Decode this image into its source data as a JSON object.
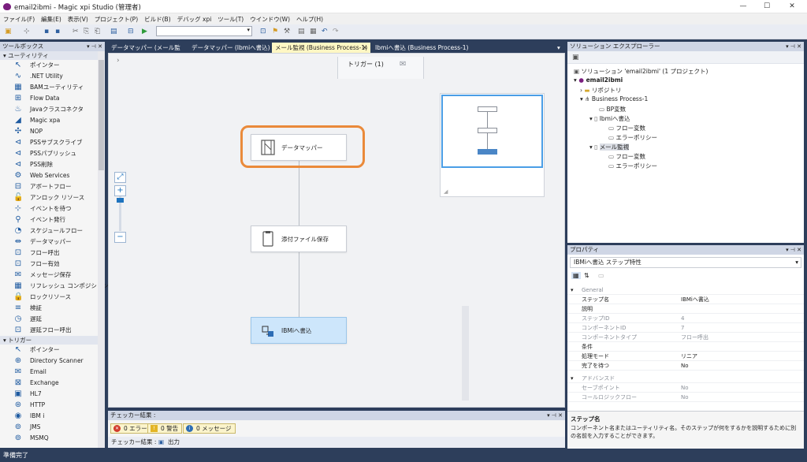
{
  "window": {
    "title": "email2ibmi - Magic xpi Studio (管理者)",
    "minimize": "—",
    "maximize": "☐",
    "close": "✕"
  },
  "menu": [
    "ファイル(F)",
    "編集(E)",
    "表示(V)",
    "プロジェクト(P)",
    "ビルド(B)",
    "デバッグ xpi",
    "ツール(T)",
    "ウインドウ(W)",
    "ヘルプ(H)"
  ],
  "toolbox": {
    "title": "ツールボックス",
    "pin_icons": "▾ ⊣ ✕",
    "utility_section": "▾ ユーティリティ",
    "utility_items": [
      {
        "label": "ポインター",
        "icon": "pointer-icon",
        "glyph": "↖"
      },
      {
        "label": ".NET Utility",
        "icon": "dotnet-icon",
        "glyph": "∿"
      },
      {
        "label": "BAMユーティリティ",
        "icon": "bam-icon",
        "glyph": "▦"
      },
      {
        "label": "Flow Data",
        "icon": "flow-data-icon",
        "glyph": "⊞"
      },
      {
        "label": "Javaクラスコネクタ",
        "icon": "java-icon",
        "glyph": "♨"
      },
      {
        "label": "Magic xpa",
        "icon": "magic-xpa-icon",
        "glyph": "◢"
      },
      {
        "label": "NOP",
        "icon": "nop-icon",
        "glyph": "✣"
      },
      {
        "label": "PSSサブスクライブ",
        "icon": "pss-subscribe-icon",
        "glyph": "⊲"
      },
      {
        "label": "PSSパブリッシュ",
        "icon": "pss-publish-icon",
        "glyph": "⊲"
      },
      {
        "label": "PSS削除",
        "icon": "pss-delete-icon",
        "glyph": "⊲"
      },
      {
        "label": "Web Services",
        "icon": "web-services-icon",
        "glyph": "⚙"
      },
      {
        "label": "アボートフロー",
        "icon": "abort-flow-icon",
        "glyph": "⊟"
      },
      {
        "label": "アンロック リソース",
        "icon": "unlock-icon",
        "glyph": "🔓"
      },
      {
        "label": "イベントを待つ",
        "icon": "wait-event-icon",
        "glyph": "⊹"
      },
      {
        "label": "イベント発行",
        "icon": "raise-event-icon",
        "glyph": "⚲"
      },
      {
        "label": "スケジュールフロー",
        "icon": "schedule-flow-icon",
        "glyph": "◔"
      },
      {
        "label": "データマッパー",
        "icon": "data-mapper-icon",
        "glyph": "⇹"
      },
      {
        "label": "フロー呼出",
        "icon": "call-flow-icon",
        "glyph": "⊡"
      },
      {
        "label": "フロー有効",
        "icon": "flow-enable-icon",
        "glyph": "⊡"
      },
      {
        "label": "メッセージ保存",
        "icon": "save-message-icon",
        "glyph": "✉"
      },
      {
        "label": "リフレッシュ コンポジション",
        "icon": "refresh-icon",
        "glyph": "▦"
      },
      {
        "label": "ロックリソース",
        "icon": "lock-icon",
        "glyph": "🔒"
      },
      {
        "label": "検証",
        "icon": "validate-icon",
        "glyph": "≡"
      },
      {
        "label": "遅延",
        "icon": "delay-icon",
        "glyph": "◷"
      },
      {
        "label": "遅延フロー呼出",
        "icon": "delay-flow-icon",
        "glyph": "⊡"
      }
    ],
    "trigger_section": "▾ トリガー",
    "trigger_items": [
      {
        "label": "ポインター",
        "icon": "pointer-icon",
        "glyph": "↖"
      },
      {
        "label": "Directory Scanner",
        "icon": "directory-scanner-icon",
        "glyph": "⊕"
      },
      {
        "label": "Email",
        "icon": "email-icon",
        "glyph": "✉"
      },
      {
        "label": "Exchange",
        "icon": "exchange-icon",
        "glyph": "⊠"
      },
      {
        "label": "HL7",
        "icon": "hl7-icon",
        "glyph": "▣"
      },
      {
        "label": "HTTP",
        "icon": "http-icon",
        "glyph": "⊛"
      },
      {
        "label": "IBM i",
        "icon": "ibmi-icon",
        "glyph": "◉"
      },
      {
        "label": "JMS",
        "icon": "jms-icon",
        "glyph": "⊚"
      },
      {
        "label": "MSMQ",
        "icon": "msmq-icon",
        "glyph": "⊚"
      }
    ]
  },
  "tabs": [
    {
      "label": "データマッパー (メール監視)",
      "active": false
    },
    {
      "label": "データマッパー (Ibmiへ書込)",
      "active": false
    },
    {
      "label": "メール監視 (Business Process-1)",
      "active": true
    },
    {
      "label": "Ibmiへ書込 (Business Process-1)",
      "active": false
    }
  ],
  "tab_close": "✕",
  "tab_dropdown": "▾",
  "canvas": {
    "collapse_arrow": "›",
    "trigger_label": "トリガー (1)",
    "steps": [
      {
        "label": "データマッパー",
        "highlight": true
      },
      {
        "label": "添付ファイル保存",
        "highlight": false
      },
      {
        "label": "IBMiへ書込",
        "highlight": false,
        "selected": true
      }
    ],
    "zoom_plus": "+",
    "zoom_minus": "−",
    "zoom_fit": "⤢",
    "zoom_level": 0.3
  },
  "solution": {
    "title": "ソリューション エクスプローラー",
    "root": "ソリューション 'email2ibmi' (1 プロジェクト)",
    "project": "email2ibmi",
    "repository": "リポジトリ",
    "bp": "Business Process-1",
    "bp_var": "BP変数",
    "flow1": "Ibmiへ書込",
    "flow1_var": "フロー変数",
    "flow1_err": "エラーポリシー",
    "flow2": "メール監視",
    "flow2_var": "フロー変数",
    "flow2_err": "エラーポリシー"
  },
  "properties": {
    "title": "プロパティ",
    "object": "IBMiへ書込 ステップ特性",
    "general_section": "General",
    "rows": [
      {
        "k": "ステップ名",
        "v": "IBMiへ書込",
        "disabled": false
      },
      {
        "k": "説明",
        "v": "",
        "disabled": false
      },
      {
        "k": "ステップID",
        "v": "4",
        "disabled": true
      },
      {
        "k": "コンポーネントID",
        "v": "7",
        "disabled": true
      },
      {
        "k": "コンポーネントタイプ",
        "v": "フロー呼出",
        "disabled": true
      },
      {
        "k": "条件",
        "v": "",
        "disabled": false
      },
      {
        "k": "処理モード",
        "v": "リニア",
        "disabled": false
      },
      {
        "k": "完了を待つ",
        "v": "No",
        "disabled": false
      }
    ],
    "advanced_section": "アドバンスド",
    "adv_rows": [
      {
        "k": "セーブポイント",
        "v": "No",
        "disabled": true
      },
      {
        "k": "コールロジックフロー",
        "v": "No",
        "disabled": true
      }
    ],
    "desc_title": "ステップ名",
    "desc_text": "コンポーネント名またはユーティリティ名。そのステップが何をするかを説明するために別の名前を入力することができます。"
  },
  "checker": {
    "title": "チェッカー結果 :",
    "errors": "0 エラー",
    "warnings": "0 警告",
    "messages": "0 メッセージ",
    "bottom_label": "チェッカー結果 :",
    "output_label": "出力"
  },
  "status": "準備完了",
  "colors": {
    "accent": "#2d3e5b",
    "highlight": "#ea8a3a",
    "active_tab": "#fff7c4",
    "selected_step": "#cde6fb"
  }
}
